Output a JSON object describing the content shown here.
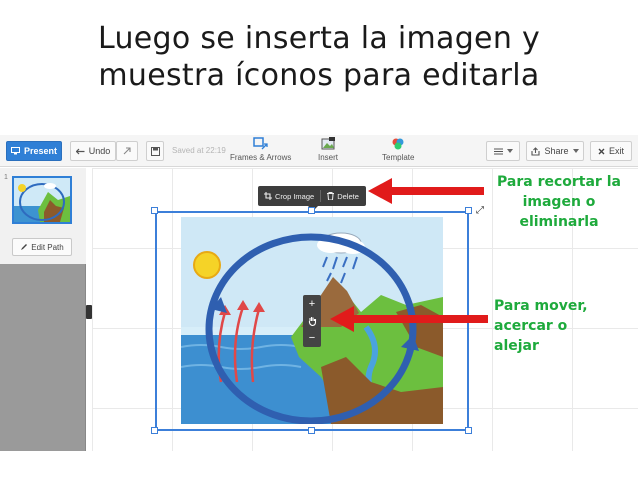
{
  "slide": {
    "title_line1": "Luego se inserta la imagen y",
    "title_line2": "muestra íconos para editarla"
  },
  "toolbar": {
    "present_label": "Present",
    "undo_label": "Undo",
    "saved_text": "Saved at 22:19",
    "frames_label": "Frames & Arrows",
    "insert_label": "Insert",
    "template_label": "Template",
    "share_label": "Share",
    "exit_label": "Exit"
  },
  "sidebar": {
    "thumb_number": "1",
    "edit_path_label": "Edit Path"
  },
  "image_popup": {
    "crop_label": "Crop Image",
    "delete_label": "Delete"
  },
  "zoom_controls": {
    "plus": "+",
    "minus": "−"
  },
  "annotations": {
    "top": [
      "Para recortar la",
      "imagen o",
      "eliminarla"
    ],
    "middle": [
      "Para mover,",
      "acercar o",
      "alejar"
    ]
  },
  "colors": {
    "annotation_text": "#1eaa3c",
    "arrow": "#e11b1b",
    "selection": "#3c7fd9",
    "present_button": "#2f7fd6"
  }
}
